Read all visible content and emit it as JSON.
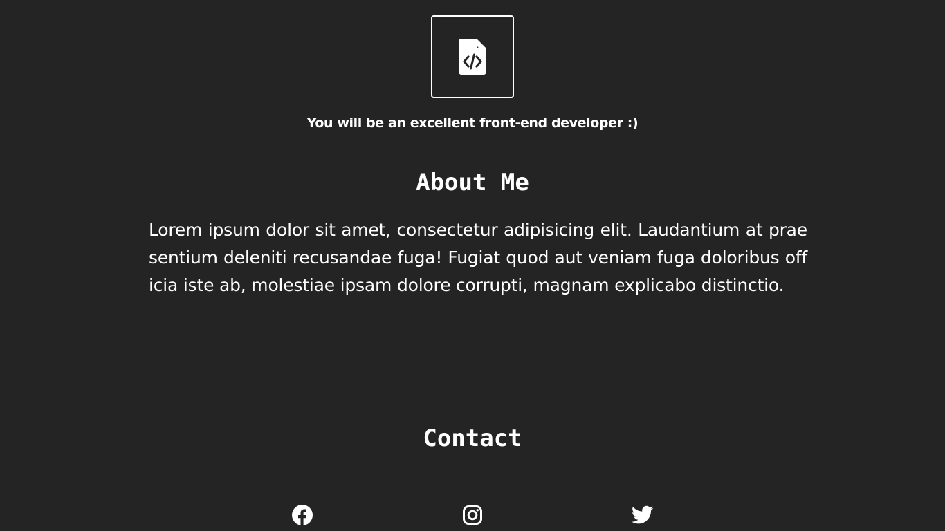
{
  "logo": {
    "icon": "file-code-icon"
  },
  "tagline": "You will be an excellent front-end developer :)",
  "about": {
    "title": "About Me",
    "text": "Lorem ipsum dolor sit amet, consectetur adipisicing elit. Laudantium at praesentium deleniti recusandae fuga! Fugiat quod aut veniam fuga doloribus officia iste ab, molestiae ipsam dolore corrupti, magnam explicabo distinctio."
  },
  "contact": {
    "title": "Contact",
    "links": [
      {
        "icon": "facebook-icon"
      },
      {
        "icon": "instagram-icon"
      },
      {
        "icon": "twitter-icon"
      }
    ]
  },
  "colors": {
    "background": "#242424",
    "text": "#ffffff"
  }
}
